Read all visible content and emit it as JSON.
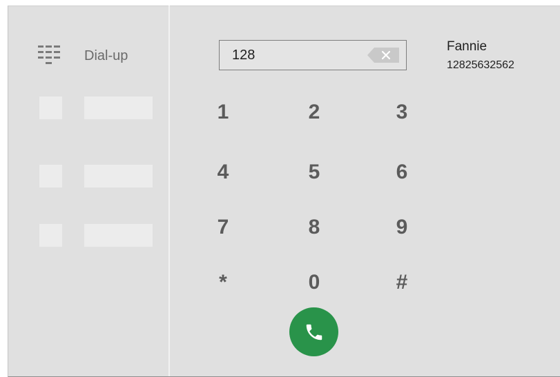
{
  "sidebar": {
    "dial_label": "Dial-up"
  },
  "dialer": {
    "number_value": "128",
    "keys": [
      "1",
      "2",
      "3",
      "4",
      "5",
      "6",
      "7",
      "8",
      "9",
      "*",
      "0",
      "#"
    ]
  },
  "suggestion": {
    "name": "Fannie",
    "number": "12825632562"
  },
  "colors": {
    "background": "#e0e0e0",
    "key_text": "#5b5b5b",
    "call_button": "#29934a",
    "placeholder": "#ececec"
  },
  "icons": {
    "dial": "dialpad-list-icon",
    "backspace": "backspace-icon",
    "call": "phone-icon"
  }
}
